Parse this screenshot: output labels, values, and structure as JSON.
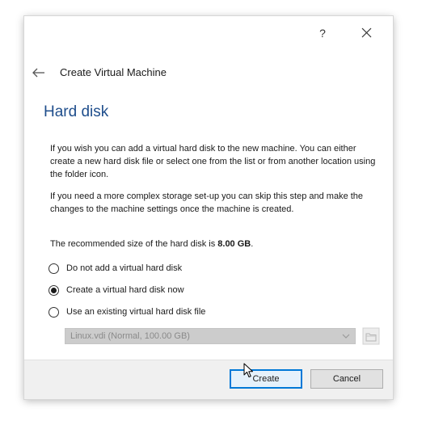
{
  "titlebar": {
    "help_label": "?",
    "close_icon": "close-icon"
  },
  "nav": {
    "back_icon": "back-arrow-icon",
    "title": "Create Virtual Machine"
  },
  "page": {
    "heading": "Hard disk",
    "paragraph1": "If you wish you can add a virtual hard disk to the new machine. You can either create a new hard disk file or select one from the list or from another location using the folder icon.",
    "paragraph2": "If you need a more complex storage set-up you can skip this step and make the changes to the machine settings once the machine is created.",
    "recommended_prefix": "The recommended size of the hard disk is ",
    "recommended_size": "8.00 GB",
    "recommended_suffix": "."
  },
  "options": [
    {
      "label": "Do not add a virtual hard disk",
      "selected": false
    },
    {
      "label": "Create a virtual hard disk now",
      "selected": true
    },
    {
      "label": "Use an existing virtual hard disk file",
      "selected": false
    }
  ],
  "existing_disk": {
    "selected_value": "Linux.vdi (Normal, 100.00 GB)",
    "enabled": false,
    "folder_icon": "folder-icon"
  },
  "footer": {
    "create_label": "Create",
    "cancel_label": "Cancel"
  },
  "colors": {
    "heading": "#1f4e8c",
    "default_button_border": "#0078d7",
    "footer_background": "#f0f0f0"
  }
}
